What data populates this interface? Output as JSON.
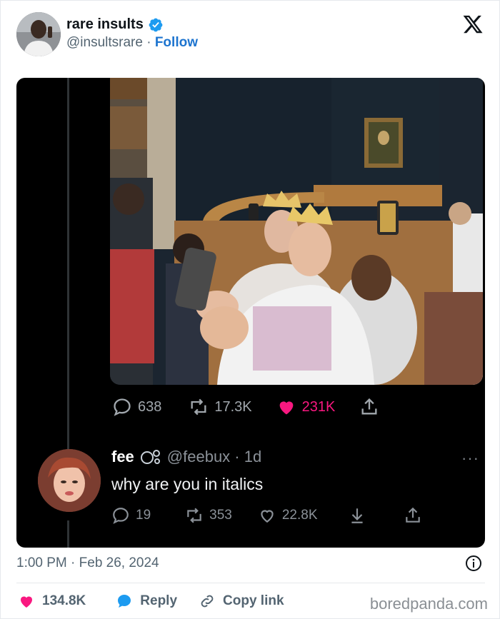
{
  "tweet": {
    "author_name": "rare insults",
    "author_handle": "@insultsrare",
    "separator": "·",
    "follow_label": "Follow",
    "timestamp": "1:00 PM · Feb 26, 2024"
  },
  "embedded": {
    "metrics": {
      "replies": "638",
      "retweets": "17.3K",
      "likes": "231K"
    },
    "reply": {
      "display_name": "fee",
      "handle_time": "@feebux · 1d",
      "text": "why are you in italics",
      "replies": "19",
      "retweets": "353",
      "likes": "22.8K",
      "more": "···"
    }
  },
  "actions": {
    "like_count": "134.8K",
    "reply_label": "Reply",
    "copy_label": "Copy link"
  },
  "watermark": "boredpanda.com",
  "colors": {
    "verified": "#1d9bf0",
    "follow": "#1d74cf",
    "like_pink": "#f91880",
    "reply_blue": "#1d9bf0"
  },
  "icons": {
    "x_logo": "x-logo-icon",
    "verified": "verified-badge-icon",
    "info": "info-icon"
  }
}
